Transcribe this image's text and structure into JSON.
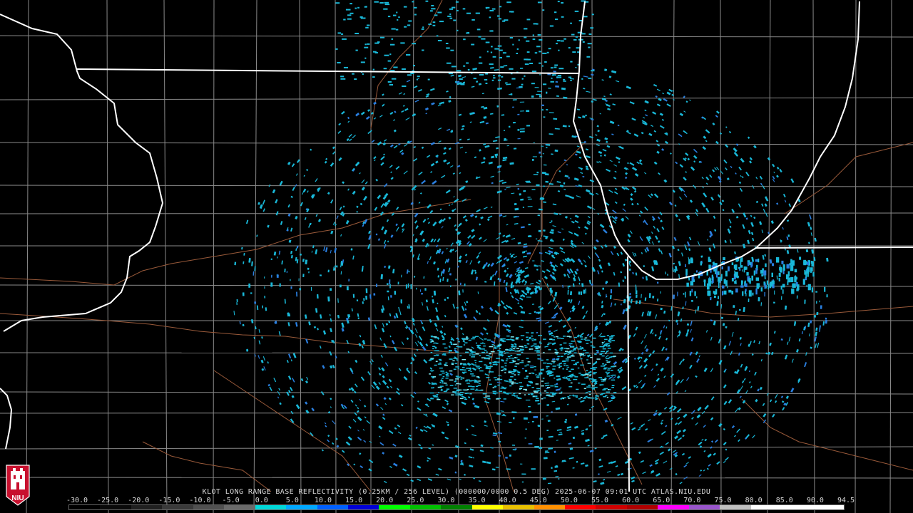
{
  "product_caption": "KLOT LONG RANGE BASE REFLECTIVITY (0.25KM / 256 LEVEL) (000000/0000 0.5 DEG) 2025-06-07 09:01 UTC  ATLAS.NIU.EDU",
  "logo_text": "NIU",
  "scale": {
    "labels": [
      "-30.0",
      "-25.0",
      "-20.0",
      "-15.0",
      "-10.0",
      "-5.0",
      "0.0",
      "5.0",
      "10.0",
      "15.0",
      "20.0",
      "25.0",
      "30.0",
      "35.0",
      "40.0",
      "45.0",
      "50.0",
      "55.0",
      "60.0",
      "65.0",
      "70.0",
      "75.0",
      "80.0",
      "85.0",
      "90.0",
      "94.5"
    ],
    "colors": [
      "#000000",
      "#0a0a0a",
      "#202020",
      "#3a3a3a",
      "#505050",
      "#6a6a6a",
      "#00d8d8",
      "#00a8ff",
      "#0060ff",
      "#0000d8",
      "#00ff00",
      "#00c000",
      "#008000",
      "#ffff00",
      "#e8c000",
      "#ff9000",
      "#ff0000",
      "#d00000",
      "#b00000",
      "#ff00ff",
      "#9955cc",
      "#c0c0c0",
      "#ffffff",
      "#ffffff",
      "#ffffff"
    ]
  },
  "colors": {
    "background": "#000000",
    "state_border": "#ffffff",
    "county_border": "#8a8a8a",
    "highway": "#9a5a3a",
    "echo_primary": "#19b8d8",
    "echo_secondary": "#2a7fe0"
  },
  "radar_site": "KLOT"
}
